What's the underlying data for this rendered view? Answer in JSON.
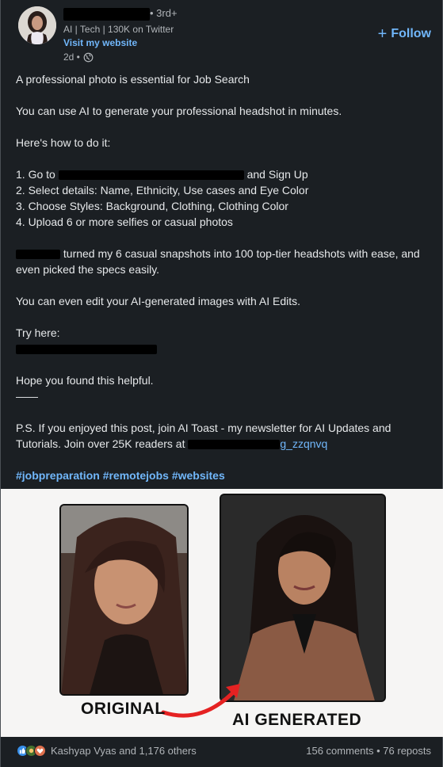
{
  "header": {
    "degree": "• 3rd+",
    "headline": "AI | Tech | 130K on Twitter",
    "website": "Visit my website",
    "timestamp": "2d •",
    "follow_label": "Follow"
  },
  "post": {
    "line1": "A professional photo is essential for Job Search",
    "line2": "You can use AI to generate your professional headshot in minutes.",
    "line3": "Here's how to do it:",
    "step1_prefix": "1. Go to",
    "step1_link_tail": "",
    "step1_suffix": "and Sign Up",
    "step2": "2. Select details: Name, Ethnicity, Use cases and Eye Color",
    "step3": "3. Choose Styles: Background, Clothing, Clothing Color",
    "step4": "4. Upload 6 or more selfies or casual photos",
    "para1_line1": "turned my 6 casual snapshots into 100 top-tier headshots with ease, and",
    "para1_line2": "even picked the specs easily.",
    "para2": "You can even edit your AI-generated images with AI Edits.",
    "try_here": "Try here:",
    "hope": "Hope you found this helpful.",
    "divider": "——",
    "ps_line1": "P.S. If you enjoyed this post, join AI Toast - my newsletter for AI Updates and",
    "ps_line2_prefix": "Tutorials. Join over 25K readers at",
    "ps_link_tail": "g_zzqnvq",
    "hashtags": [
      "#jobpreparation",
      "#remotejobs",
      "#websites"
    ]
  },
  "image": {
    "caption_original": "ORIGINAL",
    "caption_ai": "AI GENERATED"
  },
  "footer": {
    "reactors": "Kashyap Vyas and 1,176 others",
    "stats": "156 comments • 76 reposts"
  },
  "colors": {
    "background": "#1b1f23",
    "link": "#71b7fb",
    "arrow": "#e52222"
  },
  "icons": [
    "globe-icon",
    "plus-icon",
    "like-icon",
    "celebrate-icon",
    "love-icon",
    "arrow-icon"
  ]
}
